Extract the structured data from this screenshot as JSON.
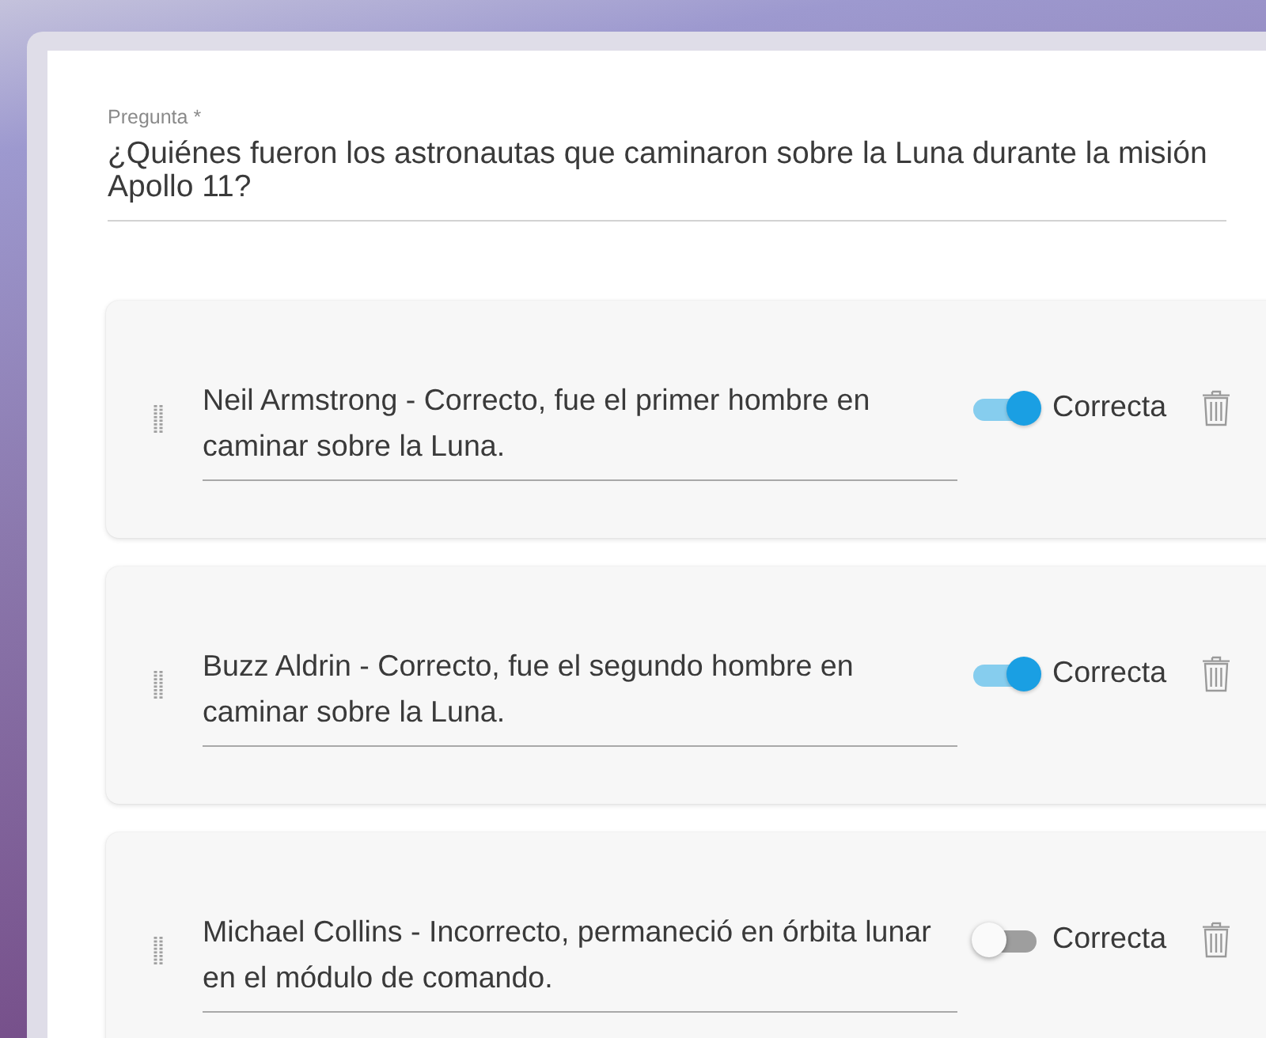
{
  "question": {
    "label": "Pregunta *",
    "value": "¿Quiénes fueron los astronautas que caminaron sobre la Luna durante la misión Apollo 11?"
  },
  "answers": [
    {
      "text": "Neil Armstrong - Correcto, fue el primer hombre en caminar sobre la Luna.",
      "correct": true,
      "toggle_label": "Correcta"
    },
    {
      "text": "Buzz Aldrin - Correcto, fue el segundo hombre en caminar sobre la Luna.",
      "correct": true,
      "toggle_label": "Correcta"
    },
    {
      "text": "Michael Collins - Incorrecto, permaneció en órbita lunar en el módulo de comando.",
      "correct": false,
      "toggle_label": "Correcta"
    }
  ]
}
